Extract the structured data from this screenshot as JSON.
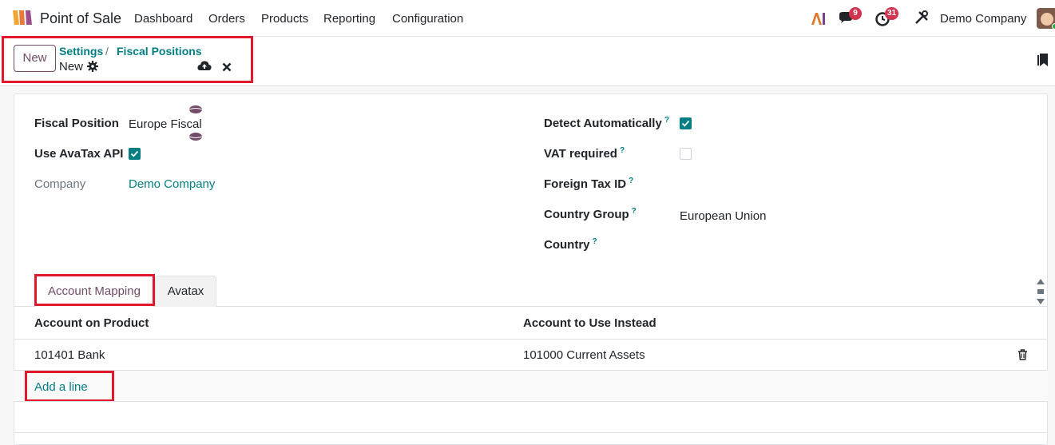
{
  "navbar": {
    "app_name": "Point of Sale",
    "menu": [
      "Dashboard",
      "Orders",
      "Products",
      "Reporting",
      "Configuration"
    ],
    "messages_count": "9",
    "activities_count": "31",
    "company": "Demo Company",
    "icons": [
      "pos-logo-icon",
      "ai-icon",
      "chat-icon",
      "clock-icon",
      "tools-icon"
    ]
  },
  "control_panel": {
    "new_label": "New",
    "breadcrumb": [
      "Settings",
      "Fiscal Positions"
    ],
    "breadcrumb_sep": "/",
    "record_name": "New"
  },
  "form": {
    "fiscal_position_label": "Fiscal Position",
    "fiscal_position_value": "Europe Fiscal",
    "use_avatax_label": "Use AvaTax API",
    "use_avatax_checked": true,
    "company_label": "Company",
    "company_value": "Demo Company",
    "detect_auto_label": "Detect Automatically",
    "detect_auto_checked": true,
    "vat_required_label": "VAT required",
    "vat_required_checked": false,
    "foreign_tax_label": "Foreign Tax ID",
    "country_group_label": "Country Group",
    "country_group_value": "European Union",
    "country_label": "Country",
    "help_mark": "?"
  },
  "tabs": {
    "account_mapping": "Account Mapping",
    "avatax": "Avatax",
    "active": "Account Mapping"
  },
  "table": {
    "headers": [
      "Account on Product",
      "Account to Use Instead"
    ],
    "rows": [
      {
        "product_account": "101401 Bank",
        "replacement_account": "101000 Current Assets"
      }
    ],
    "add_line": "Add a line"
  },
  "colors": {
    "brand": "#714b67",
    "link": "#017e84",
    "badge": "#d2334f",
    "highlight": "#e0182d"
  }
}
